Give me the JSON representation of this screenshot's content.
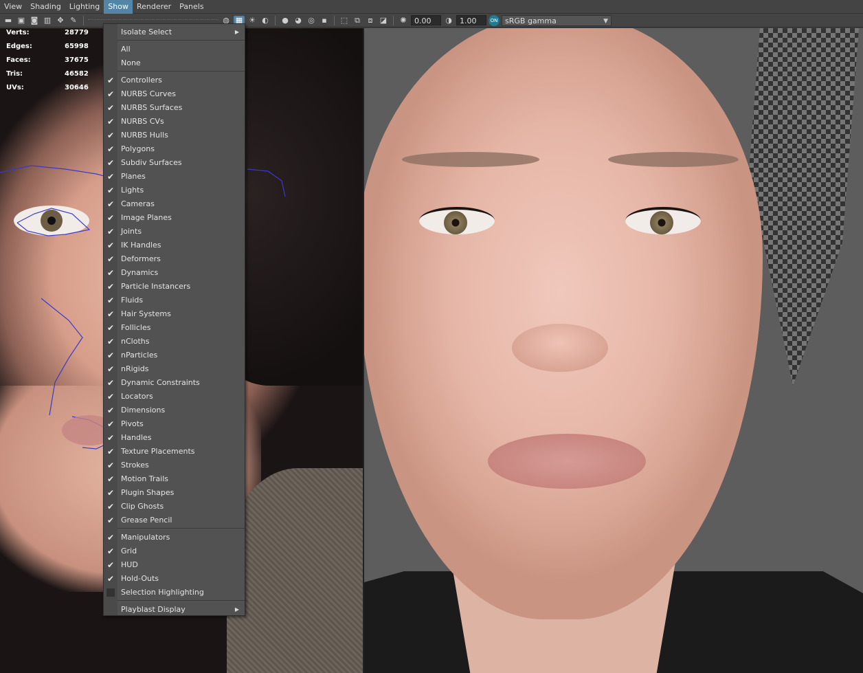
{
  "menubar": {
    "items": [
      {
        "label": "View",
        "active": false
      },
      {
        "label": "Shading",
        "active": false
      },
      {
        "label": "Lighting",
        "active": false
      },
      {
        "label": "Show",
        "active": true
      },
      {
        "label": "Renderer",
        "active": false
      },
      {
        "label": "Panels",
        "active": false
      }
    ]
  },
  "toolbar": {
    "exposure_value": "0.00",
    "gamma_value": "1.00",
    "color_mgmt_badge": "ON",
    "view_transform": "sRGB gamma"
  },
  "hud": {
    "rows": [
      {
        "label": "Verts:",
        "value": "28779"
      },
      {
        "label": "Edges:",
        "value": "65998"
      },
      {
        "label": "Faces:",
        "value": "37675"
      },
      {
        "label": "Tris:",
        "value": "46582"
      },
      {
        "label": "UVs:",
        "value": "30646"
      }
    ]
  },
  "show_menu": {
    "isolate_select": "Isolate Select",
    "all": "All",
    "none": "None",
    "items": [
      {
        "label": "Controllers",
        "checked": true
      },
      {
        "label": "NURBS Curves",
        "checked": true
      },
      {
        "label": "NURBS Surfaces",
        "checked": true
      },
      {
        "label": "NURBS CVs",
        "checked": true
      },
      {
        "label": "NURBS Hulls",
        "checked": true
      },
      {
        "label": "Polygons",
        "checked": true
      },
      {
        "label": "Subdiv Surfaces",
        "checked": true
      },
      {
        "label": "Planes",
        "checked": true
      },
      {
        "label": "Lights",
        "checked": true
      },
      {
        "label": "Cameras",
        "checked": true
      },
      {
        "label": "Image Planes",
        "checked": true
      },
      {
        "label": "Joints",
        "checked": true
      },
      {
        "label": "IK Handles",
        "checked": true
      },
      {
        "label": "Deformers",
        "checked": true
      },
      {
        "label": "Dynamics",
        "checked": true
      },
      {
        "label": "Particle Instancers",
        "checked": true
      },
      {
        "label": "Fluids",
        "checked": true
      },
      {
        "label": "Hair Systems",
        "checked": true
      },
      {
        "label": "Follicles",
        "checked": true
      },
      {
        "label": "nCloths",
        "checked": true
      },
      {
        "label": "nParticles",
        "checked": true
      },
      {
        "label": "nRigids",
        "checked": true
      },
      {
        "label": "Dynamic Constraints",
        "checked": true
      },
      {
        "label": "Locators",
        "checked": true
      },
      {
        "label": "Dimensions",
        "checked": true
      },
      {
        "label": "Pivots",
        "checked": true
      },
      {
        "label": "Handles",
        "checked": true
      },
      {
        "label": "Texture Placements",
        "checked": true
      },
      {
        "label": "Strokes",
        "checked": true
      },
      {
        "label": "Motion Trails",
        "checked": true
      },
      {
        "label": "Plugin Shapes",
        "checked": true
      },
      {
        "label": "Clip Ghosts",
        "checked": true
      },
      {
        "label": "Grease Pencil",
        "checked": true
      }
    ],
    "display_items": [
      {
        "label": "Manipulators",
        "checked": true
      },
      {
        "label": "Grid",
        "checked": true
      },
      {
        "label": "HUD",
        "checked": true
      },
      {
        "label": "Hold-Outs",
        "checked": true
      },
      {
        "label": "Selection Highlighting",
        "checked": false
      }
    ],
    "playblast_display": "Playblast Display"
  },
  "colors": {
    "accent": "#5285a6",
    "menu_bg": "#525252",
    "panel_bg": "#444444"
  }
}
